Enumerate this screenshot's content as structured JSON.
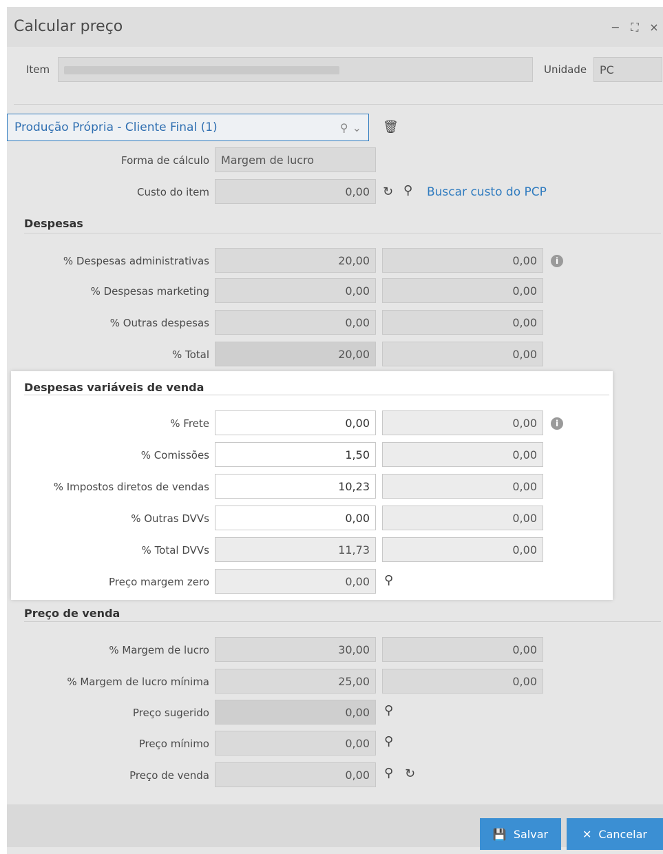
{
  "window": {
    "title": "Calcular preço",
    "minimize": "−",
    "maximize": "⛶",
    "close": "×"
  },
  "header": {
    "item_label": "Item",
    "item_value": "",
    "unidade_label": "Unidade",
    "unidade_value": "PC"
  },
  "profile": {
    "selected": "Produção Própria - Cliente Final (1)",
    "forma_label": "Forma de cálculo",
    "forma_value": "Margem de lucro",
    "custo_label": "Custo do item",
    "custo_value": "0,00",
    "buscar_link": "Buscar custo do PCP"
  },
  "despesas": {
    "title": "Despesas",
    "rows": [
      {
        "label": "% Despesas administrativas",
        "value": "20,00",
        "calc": "0,00"
      },
      {
        "label": "% Despesas marketing",
        "value": "0,00",
        "calc": "0,00"
      },
      {
        "label": "% Outras despesas",
        "value": "0,00",
        "calc": "0,00"
      },
      {
        "label": "% Total",
        "value": "20,00",
        "calc": "0,00"
      }
    ]
  },
  "dvv": {
    "title": "Despesas variáveis de venda",
    "rows": [
      {
        "label": "% Frete",
        "value": "0,00",
        "calc": "0,00"
      },
      {
        "label": "% Comissões",
        "value": "1,50",
        "calc": "0,00"
      },
      {
        "label": "% Impostos diretos de vendas",
        "value": "10,23",
        "calc": "0,00"
      },
      {
        "label": "% Outras DVVs",
        "value": "0,00",
        "calc": "0,00"
      },
      {
        "label": "% Total DVVs",
        "value": "11,73",
        "calc": "0,00"
      }
    ],
    "margem_zero_label": "Preço margem zero",
    "margem_zero_value": "0,00"
  },
  "preco": {
    "title": "Preço de venda",
    "rows": [
      {
        "label": "% Margem de lucro",
        "value": "30,00",
        "calc": "0,00"
      },
      {
        "label": "% Margem de lucro mínima",
        "value": "25,00",
        "calc": "0,00"
      }
    ],
    "sugerido_label": "Preço sugerido",
    "sugerido_value": "0,00",
    "minimo_label": "Preço mínimo",
    "minimo_value": "0,00",
    "venda_label": "Preço de venda",
    "venda_value": "0,00"
  },
  "footer": {
    "save_label": "Salvar",
    "cancel_label": "Cancelar"
  },
  "colors": {
    "accent": "#3b8fd3",
    "link": "#2f7bbf"
  }
}
